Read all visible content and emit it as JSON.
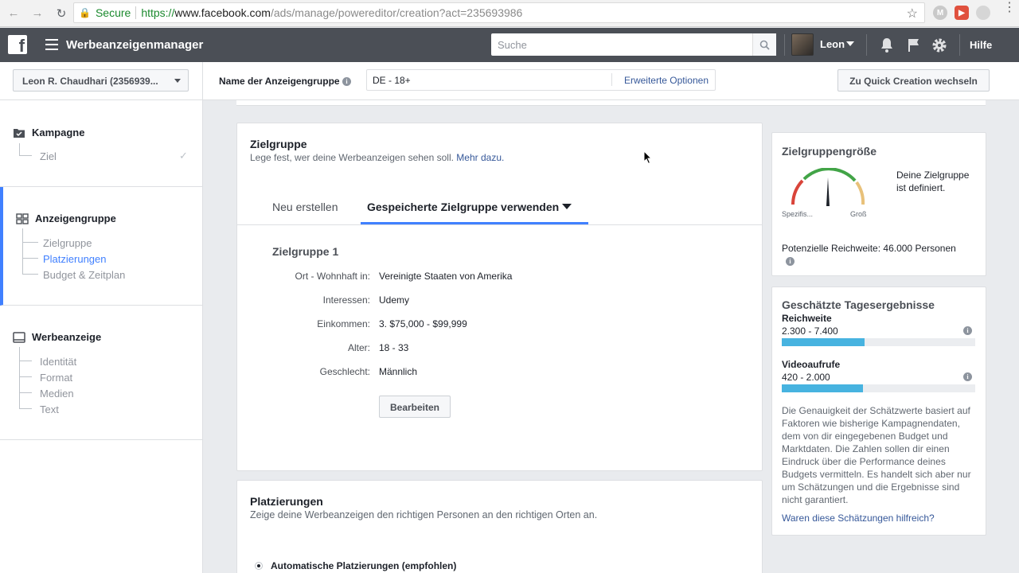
{
  "browser": {
    "secure_label": "Secure",
    "url_https": "https://",
    "url_host": "www.facebook.com",
    "url_rest": "/ads/manage/powereditor/creation?act=235693986"
  },
  "topbar": {
    "logo": "f",
    "app_title": "Werbeanzeigenmanager",
    "search_placeholder": "Suche",
    "user_name": "Leon",
    "help": "Hilfe"
  },
  "header": {
    "account_name": "Leon R. Chaudhari (2356939...",
    "adgroup_label": "Name der Anzeigengruppe",
    "adgroup_value": "DE - 18+",
    "advanced_options": "Erweiterte Optionen",
    "quick_creation": "Zu Quick Creation wechseln"
  },
  "sidebar": {
    "campaign": {
      "label": "Kampagne",
      "items": [
        {
          "label": "Ziel",
          "done": true
        }
      ]
    },
    "adgroup": {
      "label": "Anzeigengruppe",
      "items": [
        {
          "label": "Zielgruppe"
        },
        {
          "label": "Platzierungen",
          "active": true
        },
        {
          "label": "Budget & Zeitplan"
        }
      ]
    },
    "ad": {
      "label": "Werbeanzeige",
      "items": [
        {
          "label": "Identität"
        },
        {
          "label": "Format"
        },
        {
          "label": "Medien"
        },
        {
          "label": "Text"
        }
      ]
    }
  },
  "audience_card": {
    "title": "Zielgruppe",
    "subtitle": "Lege fest, wer deine Werbeanzeigen sehen soll.",
    "more_link": "Mehr dazu.",
    "tabs": [
      {
        "label": "Neu erstellen",
        "active": false
      },
      {
        "label": "Gespeicherte Zielgruppe verwenden",
        "active": true
      }
    ],
    "audience_name": "Zielgruppe 1",
    "rows": [
      {
        "label": "Ort - Wohnhaft in:",
        "value": "Vereinigte Staaten von Amerika"
      },
      {
        "label": "Interessen:",
        "value": "Udemy"
      },
      {
        "label": "Einkommen:",
        "value": "3. $75,000 - $99,999"
      },
      {
        "label": "Alter:",
        "value": "18 - 33"
      },
      {
        "label": "Geschlecht:",
        "value": "Männlich"
      }
    ],
    "edit_button": "Bearbeiten"
  },
  "placements_card": {
    "title": "Platzierungen",
    "subtitle": "Zeige deine Werbeanzeigen den richtigen Personen an den richtigen Orten an.",
    "option": "Automatische Platzierungen (empfohlen)"
  },
  "audience_size": {
    "title": "Zielgruppengröße",
    "status": "Deine Zielgruppe ist definiert.",
    "gauge_left": "Spezifis...",
    "gauge_right": "Groß",
    "reach_text": "Potenzielle Reichweite: 46.000 Personen"
  },
  "daily_results": {
    "title": "Geschätzte Tagesergebnisse",
    "metrics": [
      {
        "label": "Reichweite",
        "value": "2.300 - 7.400",
        "fill_fraction": 0.43
      },
      {
        "label": "Videoaufrufe",
        "value": "420 - 2.000",
        "fill_fraction": 0.42
      }
    ],
    "disclaimer": "Die Genauigkeit der Schätzwerte basiert auf Faktoren wie bisherige Kampagnendaten, dem von dir eingegebenen Budget und Marktdaten. Die Zahlen sollen dir einen Eindruck über die Performance deines Budgets vermitteln. Es handelt sich aber nur um Schätzungen und die Ergebnisse sind nicht garantiert.",
    "feedback_link": "Waren diese Schätzungen hilfreich?"
  },
  "colors": {
    "fb_bar": "#4b4f56",
    "accent": "#4080ff",
    "link": "#365899",
    "estimate_bar": "#47b3e0",
    "secure_green": "#1b8a2e"
  }
}
